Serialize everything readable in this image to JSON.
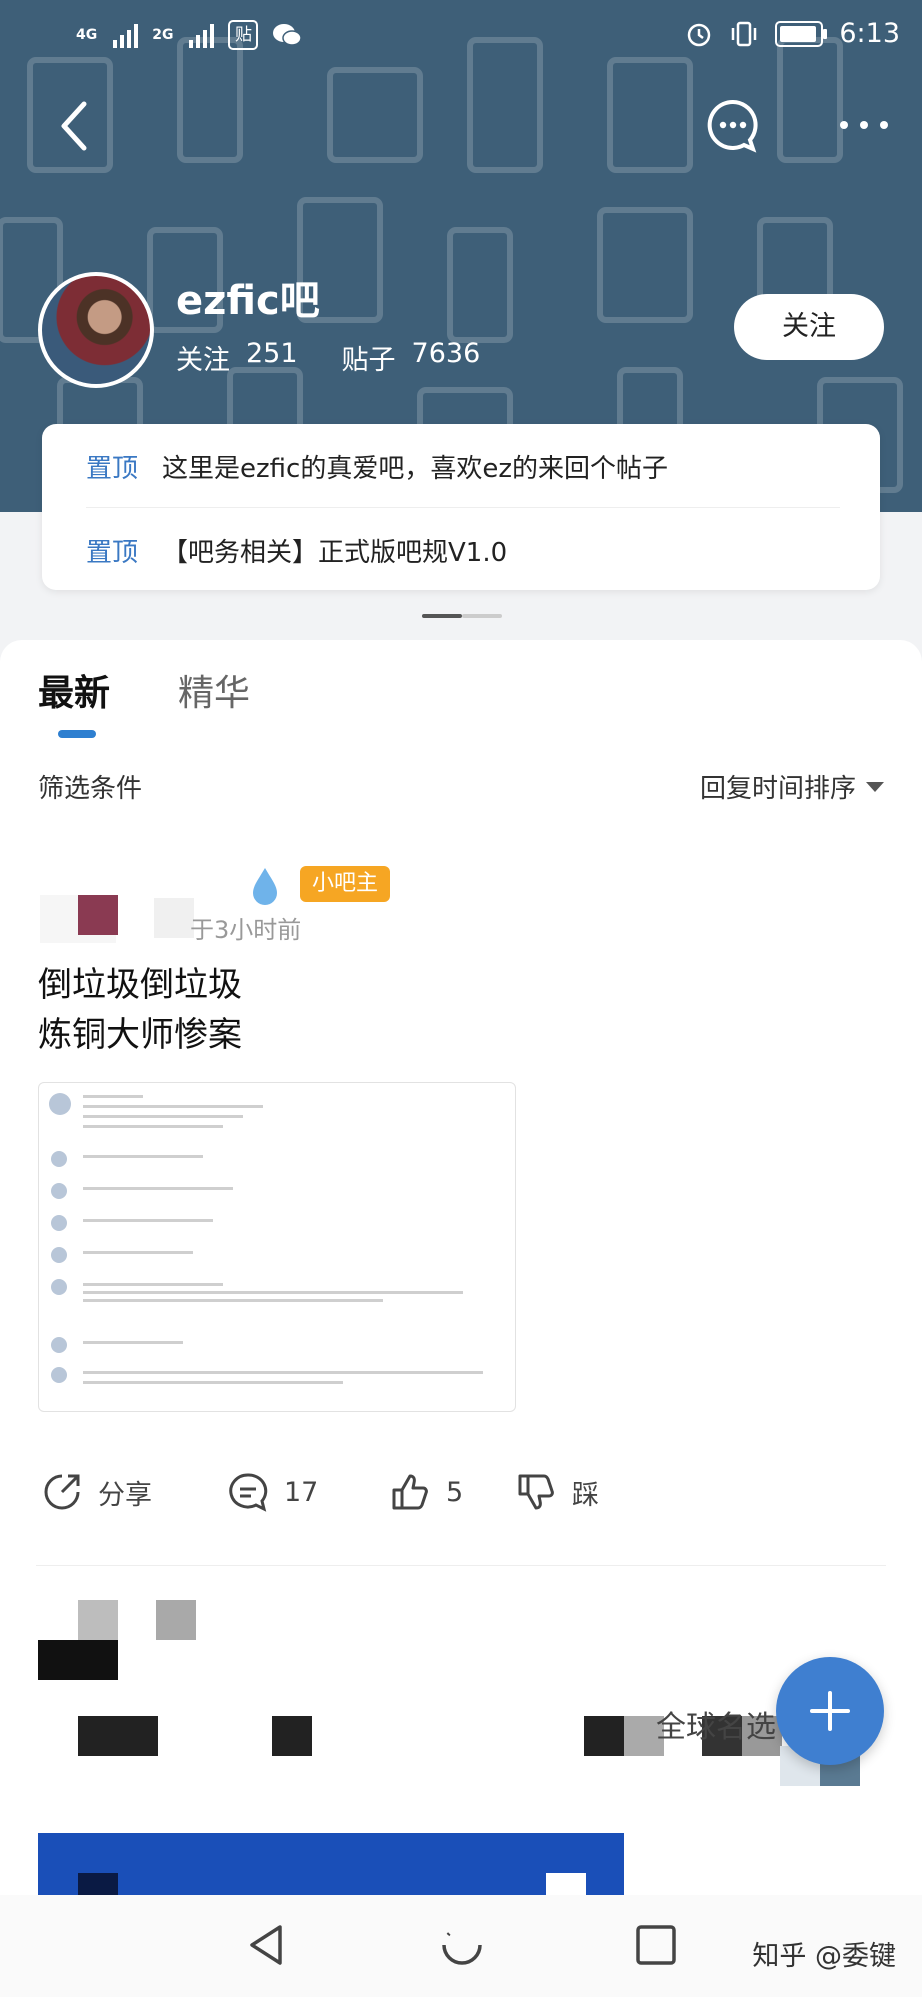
{
  "status_bar": {
    "signal_1": "4G",
    "signal_2": "2G",
    "app_badge": "贴",
    "time": "6:13"
  },
  "forum": {
    "name": "ezfic吧",
    "follow_label": "关注",
    "follow_count": "251",
    "posts_label": "贴子",
    "posts_count": "7636",
    "follow_button": "关注"
  },
  "pinned": [
    {
      "tag": "置顶",
      "text": "这里是ezfic的真爱吧，喜欢ez的来回个帖子"
    },
    {
      "tag": "置顶",
      "text": "【吧务相关】正式版吧规V1.0"
    }
  ],
  "tabs": [
    {
      "label": "最新",
      "active": true
    },
    {
      "label": "精华",
      "active": false
    }
  ],
  "filter": {
    "label": "筛选条件",
    "sort_label": "回复时间排序"
  },
  "post": {
    "badge": "小吧主",
    "time": "于3小时前",
    "title_lines": [
      "倒垃圾倒垃圾",
      "炼铜大师惨案"
    ],
    "share_label": "分享",
    "comment_count": "17",
    "like_count": "5",
    "dislike_label": "踩"
  },
  "blurred_next_post_fragment": "全球名选",
  "watermark": "知乎 @委键",
  "colors": {
    "header_bg": "#3e5f78",
    "accent": "#2e7fd0",
    "pin_tag": "#3a78c3",
    "badge": "#f6a623",
    "fab": "#3f7fd0"
  },
  "icons": [
    "back-icon",
    "message-icon",
    "more-icon",
    "share-icon",
    "comment-icon",
    "like-icon",
    "dislike-icon",
    "add-icon",
    "nav-back-icon",
    "nav-home-icon",
    "nav-recent-icon"
  ]
}
